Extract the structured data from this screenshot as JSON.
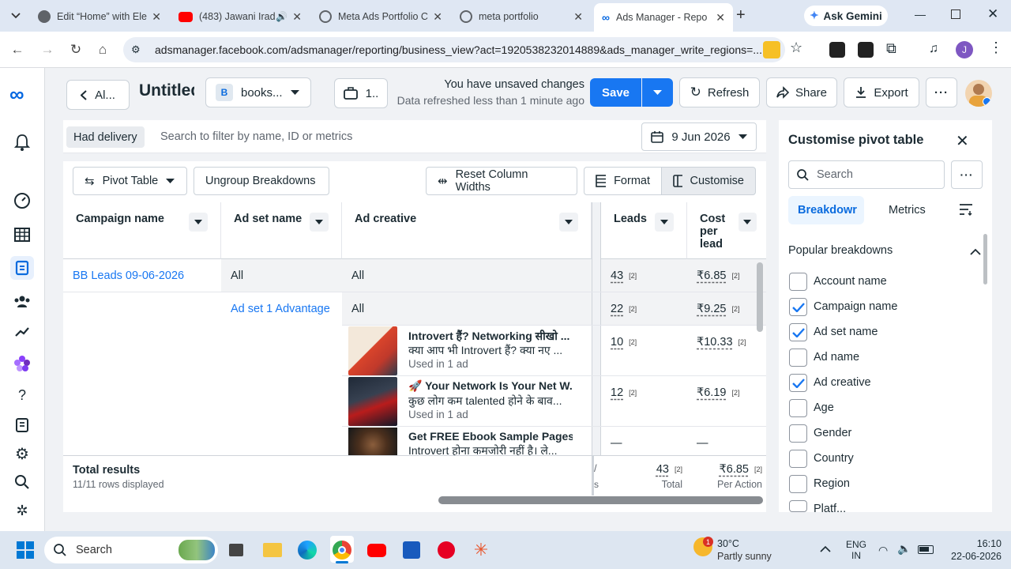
{
  "browser": {
    "tabs": [
      {
        "title": "Edit “Home” with Ele",
        "icon": "elementor-icon"
      },
      {
        "title": "(483) Jawani Irad",
        "icon": "youtube-icon"
      },
      {
        "title": "Meta Ads Portfolio C",
        "icon": "globe-icon"
      },
      {
        "title": "meta portfolio",
        "icon": "globe-icon"
      },
      {
        "title": "Ads Manager - Repo",
        "icon": "meta-icon"
      }
    ],
    "ask_gemini": "Ask Gemini",
    "url": "adsmanager.facebook.com/adsmanager/reporting/business_view?act=1920538232014889&ads_manager_write_regions=...",
    "profile_initial": "J"
  },
  "header": {
    "back_label": "Al...",
    "report_title": "Untitled",
    "account_badge": "B",
    "account_name": "books...",
    "views_label": "1..",
    "unsaved_text": "You have unsaved changes",
    "refreshed_text": "Data refreshed less than 1 minute ago",
    "save_label": "Save",
    "refresh_label": "Refresh",
    "share_label": "Share",
    "export_label": "Export"
  },
  "filter": {
    "chip": "Had delivery",
    "placeholder": "Search to filter by name, ID or metrics",
    "date": "9 Jun 2026"
  },
  "toolbar": {
    "pivot": "Pivot Table",
    "ungroup": "Ungroup Breakdowns",
    "reset": "Reset Column Widths",
    "format": "Format",
    "customise": "Customise"
  },
  "table": {
    "columns": [
      "Campaign name",
      "Ad set name",
      "Ad creative",
      "Leads",
      "Cost per lead"
    ],
    "rows": [
      {
        "campaign": "BB Leads 09-06-2026",
        "adset": "All",
        "creative": "All",
        "leads": "43",
        "leads_note": "[2]",
        "cpl": "₹6.85",
        "cpl_note": "[2]"
      },
      {
        "adset": "Ad set 1 Advantage",
        "creative": "All",
        "leads": "22",
        "leads_note": "[2]",
        "cpl": "₹9.25",
        "cpl_note": "[2]"
      },
      {
        "title": "Introvert हैं? Networking सीखो ...",
        "subtitle": "क्या आप भी Introvert हैं? क्या नए ...",
        "used": "Used in 1 ad",
        "leads": "10",
        "leads_note": "[2]",
        "cpl": "₹10.33",
        "cpl_note": "[2]"
      },
      {
        "title": "🚀 Your Network Is Your Net W...",
        "subtitle": "कुछ लोग कम talented होने के बाव...",
        "used": "Used in 1 ad",
        "leads": "12",
        "leads_note": "[2]",
        "cpl": "₹6.19",
        "cpl_note": "[2]"
      },
      {
        "title": "Get FREE Ebook Sample Pages",
        "subtitle": "Introvert होना कमजोरी नहीं है। ले...",
        "leads": "—",
        "cpl": "—"
      }
    ],
    "total": {
      "label": "Total results",
      "rows_displayed": "11/11 rows displayed",
      "left_fragment": "/",
      "left_fragment2": "s",
      "leads": "43",
      "leads_note": "[2]",
      "leads_sub": "Total",
      "cpl": "₹6.85",
      "cpl_note": "[2]",
      "cpl_sub": "Per Action"
    }
  },
  "panel": {
    "title": "Customise pivot table",
    "search_placeholder": "Search",
    "tab_breakdowns": "Breakdowr",
    "tab_metrics": "Metrics",
    "section": "Popular breakdowns",
    "items": [
      {
        "label": "Account name",
        "checked": false
      },
      {
        "label": "Campaign name",
        "checked": true
      },
      {
        "label": "Ad set name",
        "checked": true
      },
      {
        "label": "Ad name",
        "checked": false
      },
      {
        "label": "Ad creative",
        "checked": true
      },
      {
        "label": "Age",
        "checked": false
      },
      {
        "label": "Gender",
        "checked": false
      },
      {
        "label": "Country",
        "checked": false
      },
      {
        "label": "Region",
        "checked": false
      },
      {
        "label": "Platf...",
        "checked": false
      }
    ]
  },
  "taskbar": {
    "search": "Search",
    "weather_temp": "30°C",
    "weather_desc": "Partly sunny",
    "weather_badge": "1",
    "lang1": "ENG",
    "lang2": "IN",
    "time": "16:10",
    "date": "22-06-2026"
  },
  "colors": {
    "accent": "#1877f2",
    "link": "#1877f2",
    "save": "#1877f2",
    "check": "#1877f2"
  }
}
